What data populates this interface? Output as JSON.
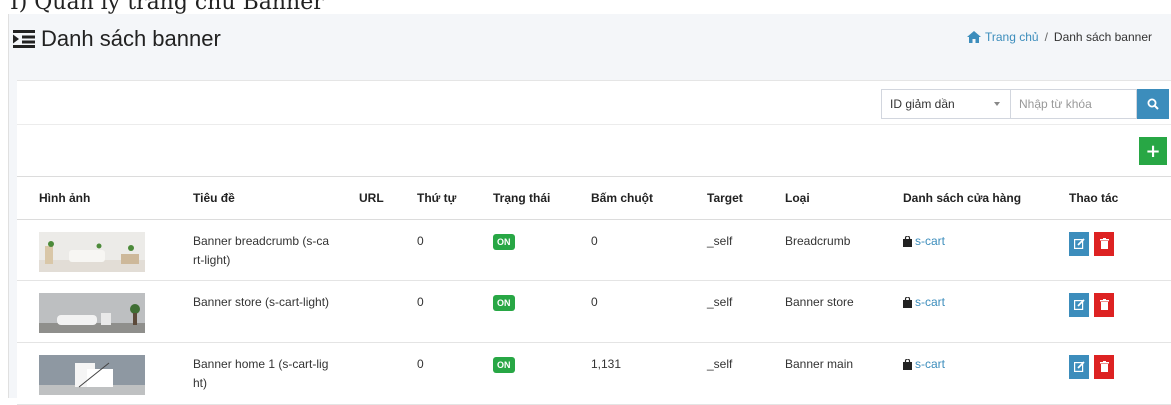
{
  "header": {
    "title": "Danh sách banner",
    "cut_text": "I) Quản lý trang chủ Banner"
  },
  "breadcrumb": {
    "home": "Trang chủ",
    "separator": "/",
    "current": "Danh sách banner"
  },
  "toolbar": {
    "sort_value": "ID giảm dần",
    "search_placeholder": "Nhập từ khóa",
    "add_label": "+"
  },
  "table": {
    "columns": [
      "Hình ảnh",
      "Tiêu đề",
      "URL",
      "Thứ tự",
      "Trạng thái",
      "Bấm chuột",
      "Target",
      "Loại",
      "Danh sách cửa hàng",
      "Thao tác"
    ],
    "rows": [
      {
        "title_l1": "Banner breadcrumb (s-ca",
        "title_l2": "rt-light)",
        "url": "",
        "order": "0",
        "status": "ON",
        "clicks": "0",
        "target": "_self",
        "type": "Breadcrumb",
        "store": "s-cart"
      },
      {
        "title_l1": "Banner store (s-cart-light)",
        "title_l2": "",
        "url": "",
        "order": "0",
        "status": "ON",
        "clicks": "0",
        "target": "_self",
        "type": "Banner store",
        "store": "s-cart"
      },
      {
        "title_l1": "Banner home 1 (s-cart-lig",
        "title_l2": "ht)",
        "url": "",
        "order": "0",
        "status": "ON",
        "clicks": "1,131",
        "target": "_self",
        "type": "Banner main",
        "store": "s-cart"
      }
    ]
  },
  "colors": {
    "primary": "#3c8dbc",
    "success": "#28a745",
    "danger": "#dd2222",
    "background": "#f4f6f9"
  }
}
